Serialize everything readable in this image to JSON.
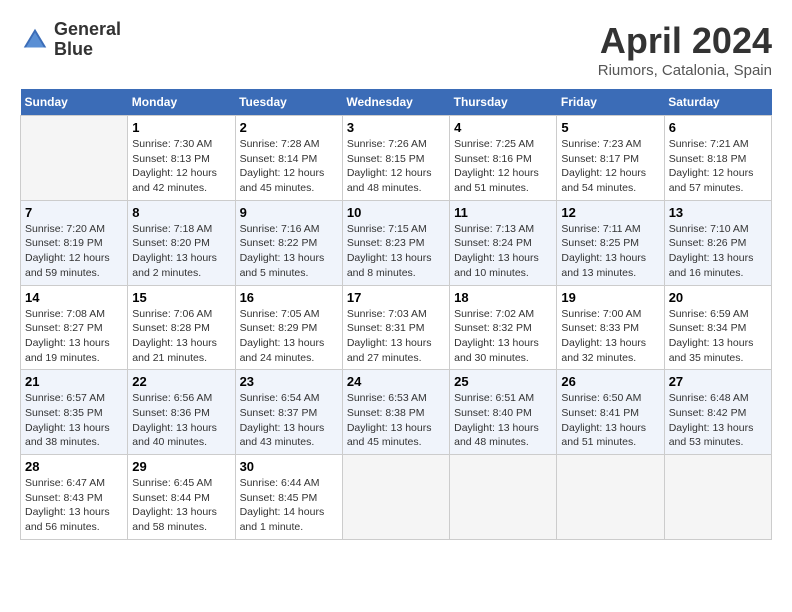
{
  "header": {
    "logo_line1": "General",
    "logo_line2": "Blue",
    "month_title": "April 2024",
    "subtitle": "Riumors, Catalonia, Spain"
  },
  "weekdays": [
    "Sunday",
    "Monday",
    "Tuesday",
    "Wednesday",
    "Thursday",
    "Friday",
    "Saturday"
  ],
  "weeks": [
    [
      {
        "day": "",
        "sunrise": "",
        "sunset": "",
        "daylight": ""
      },
      {
        "day": "1",
        "sunrise": "Sunrise: 7:30 AM",
        "sunset": "Sunset: 8:13 PM",
        "daylight": "Daylight: 12 hours and 42 minutes."
      },
      {
        "day": "2",
        "sunrise": "Sunrise: 7:28 AM",
        "sunset": "Sunset: 8:14 PM",
        "daylight": "Daylight: 12 hours and 45 minutes."
      },
      {
        "day": "3",
        "sunrise": "Sunrise: 7:26 AM",
        "sunset": "Sunset: 8:15 PM",
        "daylight": "Daylight: 12 hours and 48 minutes."
      },
      {
        "day": "4",
        "sunrise": "Sunrise: 7:25 AM",
        "sunset": "Sunset: 8:16 PM",
        "daylight": "Daylight: 12 hours and 51 minutes."
      },
      {
        "day": "5",
        "sunrise": "Sunrise: 7:23 AM",
        "sunset": "Sunset: 8:17 PM",
        "daylight": "Daylight: 12 hours and 54 minutes."
      },
      {
        "day": "6",
        "sunrise": "Sunrise: 7:21 AM",
        "sunset": "Sunset: 8:18 PM",
        "daylight": "Daylight: 12 hours and 57 minutes."
      }
    ],
    [
      {
        "day": "7",
        "sunrise": "Sunrise: 7:20 AM",
        "sunset": "Sunset: 8:19 PM",
        "daylight": "Daylight: 12 hours and 59 minutes."
      },
      {
        "day": "8",
        "sunrise": "Sunrise: 7:18 AM",
        "sunset": "Sunset: 8:20 PM",
        "daylight": "Daylight: 13 hours and 2 minutes."
      },
      {
        "day": "9",
        "sunrise": "Sunrise: 7:16 AM",
        "sunset": "Sunset: 8:22 PM",
        "daylight": "Daylight: 13 hours and 5 minutes."
      },
      {
        "day": "10",
        "sunrise": "Sunrise: 7:15 AM",
        "sunset": "Sunset: 8:23 PM",
        "daylight": "Daylight: 13 hours and 8 minutes."
      },
      {
        "day": "11",
        "sunrise": "Sunrise: 7:13 AM",
        "sunset": "Sunset: 8:24 PM",
        "daylight": "Daylight: 13 hours and 10 minutes."
      },
      {
        "day": "12",
        "sunrise": "Sunrise: 7:11 AM",
        "sunset": "Sunset: 8:25 PM",
        "daylight": "Daylight: 13 hours and 13 minutes."
      },
      {
        "day": "13",
        "sunrise": "Sunrise: 7:10 AM",
        "sunset": "Sunset: 8:26 PM",
        "daylight": "Daylight: 13 hours and 16 minutes."
      }
    ],
    [
      {
        "day": "14",
        "sunrise": "Sunrise: 7:08 AM",
        "sunset": "Sunset: 8:27 PM",
        "daylight": "Daylight: 13 hours and 19 minutes."
      },
      {
        "day": "15",
        "sunrise": "Sunrise: 7:06 AM",
        "sunset": "Sunset: 8:28 PM",
        "daylight": "Daylight: 13 hours and 21 minutes."
      },
      {
        "day": "16",
        "sunrise": "Sunrise: 7:05 AM",
        "sunset": "Sunset: 8:29 PM",
        "daylight": "Daylight: 13 hours and 24 minutes."
      },
      {
        "day": "17",
        "sunrise": "Sunrise: 7:03 AM",
        "sunset": "Sunset: 8:31 PM",
        "daylight": "Daylight: 13 hours and 27 minutes."
      },
      {
        "day": "18",
        "sunrise": "Sunrise: 7:02 AM",
        "sunset": "Sunset: 8:32 PM",
        "daylight": "Daylight: 13 hours and 30 minutes."
      },
      {
        "day": "19",
        "sunrise": "Sunrise: 7:00 AM",
        "sunset": "Sunset: 8:33 PM",
        "daylight": "Daylight: 13 hours and 32 minutes."
      },
      {
        "day": "20",
        "sunrise": "Sunrise: 6:59 AM",
        "sunset": "Sunset: 8:34 PM",
        "daylight": "Daylight: 13 hours and 35 minutes."
      }
    ],
    [
      {
        "day": "21",
        "sunrise": "Sunrise: 6:57 AM",
        "sunset": "Sunset: 8:35 PM",
        "daylight": "Daylight: 13 hours and 38 minutes."
      },
      {
        "day": "22",
        "sunrise": "Sunrise: 6:56 AM",
        "sunset": "Sunset: 8:36 PM",
        "daylight": "Daylight: 13 hours and 40 minutes."
      },
      {
        "day": "23",
        "sunrise": "Sunrise: 6:54 AM",
        "sunset": "Sunset: 8:37 PM",
        "daylight": "Daylight: 13 hours and 43 minutes."
      },
      {
        "day": "24",
        "sunrise": "Sunrise: 6:53 AM",
        "sunset": "Sunset: 8:38 PM",
        "daylight": "Daylight: 13 hours and 45 minutes."
      },
      {
        "day": "25",
        "sunrise": "Sunrise: 6:51 AM",
        "sunset": "Sunset: 8:40 PM",
        "daylight": "Daylight: 13 hours and 48 minutes."
      },
      {
        "day": "26",
        "sunrise": "Sunrise: 6:50 AM",
        "sunset": "Sunset: 8:41 PM",
        "daylight": "Daylight: 13 hours and 51 minutes."
      },
      {
        "day": "27",
        "sunrise": "Sunrise: 6:48 AM",
        "sunset": "Sunset: 8:42 PM",
        "daylight": "Daylight: 13 hours and 53 minutes."
      }
    ],
    [
      {
        "day": "28",
        "sunrise": "Sunrise: 6:47 AM",
        "sunset": "Sunset: 8:43 PM",
        "daylight": "Daylight: 13 hours and 56 minutes."
      },
      {
        "day": "29",
        "sunrise": "Sunrise: 6:45 AM",
        "sunset": "Sunset: 8:44 PM",
        "daylight": "Daylight: 13 hours and 58 minutes."
      },
      {
        "day": "30",
        "sunrise": "Sunrise: 6:44 AM",
        "sunset": "Sunset: 8:45 PM",
        "daylight": "Daylight: 14 hours and 1 minute."
      },
      {
        "day": "",
        "sunrise": "",
        "sunset": "",
        "daylight": ""
      },
      {
        "day": "",
        "sunrise": "",
        "sunset": "",
        "daylight": ""
      },
      {
        "day": "",
        "sunrise": "",
        "sunset": "",
        "daylight": ""
      },
      {
        "day": "",
        "sunrise": "",
        "sunset": "",
        "daylight": ""
      }
    ]
  ]
}
